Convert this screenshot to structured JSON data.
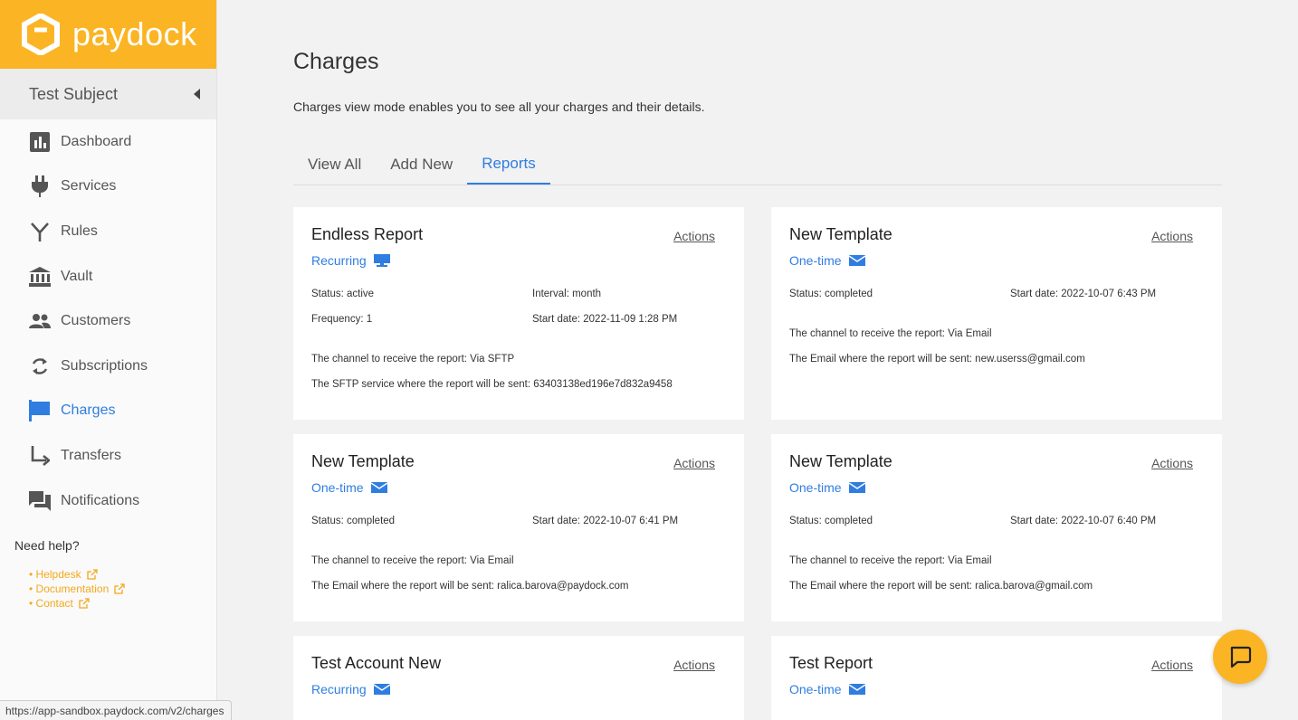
{
  "brand": {
    "name": "paydock"
  },
  "account": {
    "name": "Test Subject"
  },
  "nav": [
    {
      "label": "Dashboard",
      "icon": "bar-chart-icon"
    },
    {
      "label": "Services",
      "icon": "plug-icon"
    },
    {
      "label": "Rules",
      "icon": "split-icon"
    },
    {
      "label": "Vault",
      "icon": "bank-icon"
    },
    {
      "label": "Customers",
      "icon": "people-icon"
    },
    {
      "label": "Subscriptions",
      "icon": "refresh-icon"
    },
    {
      "label": "Charges",
      "icon": "flag-icon"
    },
    {
      "label": "Transfers",
      "icon": "transfer-arrow-icon"
    },
    {
      "label": "Notifications",
      "icon": "chat-bubbles-icon"
    }
  ],
  "help": {
    "title": "Need help?",
    "links": [
      "• Helpdesk",
      "• Documentation",
      "• Contact"
    ]
  },
  "status_url": "https://app-sandbox.paydock.com/v2/charges",
  "page": {
    "title": "Charges",
    "description": "Charges view mode enables you to see all your charges and their details.",
    "tabs": [
      "View All",
      "Add New",
      "Reports"
    ],
    "active_tab": "Reports"
  },
  "cards": [
    {
      "title": "Endless Report",
      "actions": "Actions",
      "type": "Recurring",
      "type_icon": "sftp-monitor-icon",
      "status": "Status: active",
      "interval": "Interval: month",
      "frequency": "Frequency: 1",
      "start": "Start date: 2022-11-09 1:28 PM",
      "channel": "The channel to receive the report: Via SFTP",
      "destination": "The SFTP service where the report will be sent: 63403138ed196e7d832a9458"
    },
    {
      "title": "New Template",
      "actions": "Actions",
      "type": "One-time",
      "type_icon": "envelope-icon",
      "status": "Status: completed",
      "start": "Start date: 2022-10-07 6:43 PM",
      "channel": "The channel to receive the report: Via Email",
      "destination": "The Email where the report will be sent: new.userss@gmail.com"
    },
    {
      "title": "New Template",
      "actions": "Actions",
      "type": "One-time",
      "type_icon": "envelope-icon",
      "status": "Status: completed",
      "start": "Start date: 2022-10-07 6:41 PM",
      "channel": "The channel to receive the report: Via Email",
      "destination": "The Email where the report will be sent: ralica.barova@paydock.com"
    },
    {
      "title": "New Template",
      "actions": "Actions",
      "type": "One-time",
      "type_icon": "envelope-icon",
      "status": "Status: completed",
      "start": "Start date: 2022-10-07 6:40 PM",
      "channel": "The channel to receive the report: Via Email",
      "destination": "The Email where the report will be sent: ralica.barova@gmail.com"
    },
    {
      "title": "Test Account New",
      "actions": "Actions",
      "type": "Recurring",
      "type_icon": "envelope-icon"
    },
    {
      "title": "Test Report",
      "actions": "Actions",
      "type": "One-time",
      "type_icon": "envelope-icon"
    }
  ],
  "colors": {
    "brand": "#fbb424",
    "link": "#2f7de1",
    "help_link": "#f4a81c"
  }
}
